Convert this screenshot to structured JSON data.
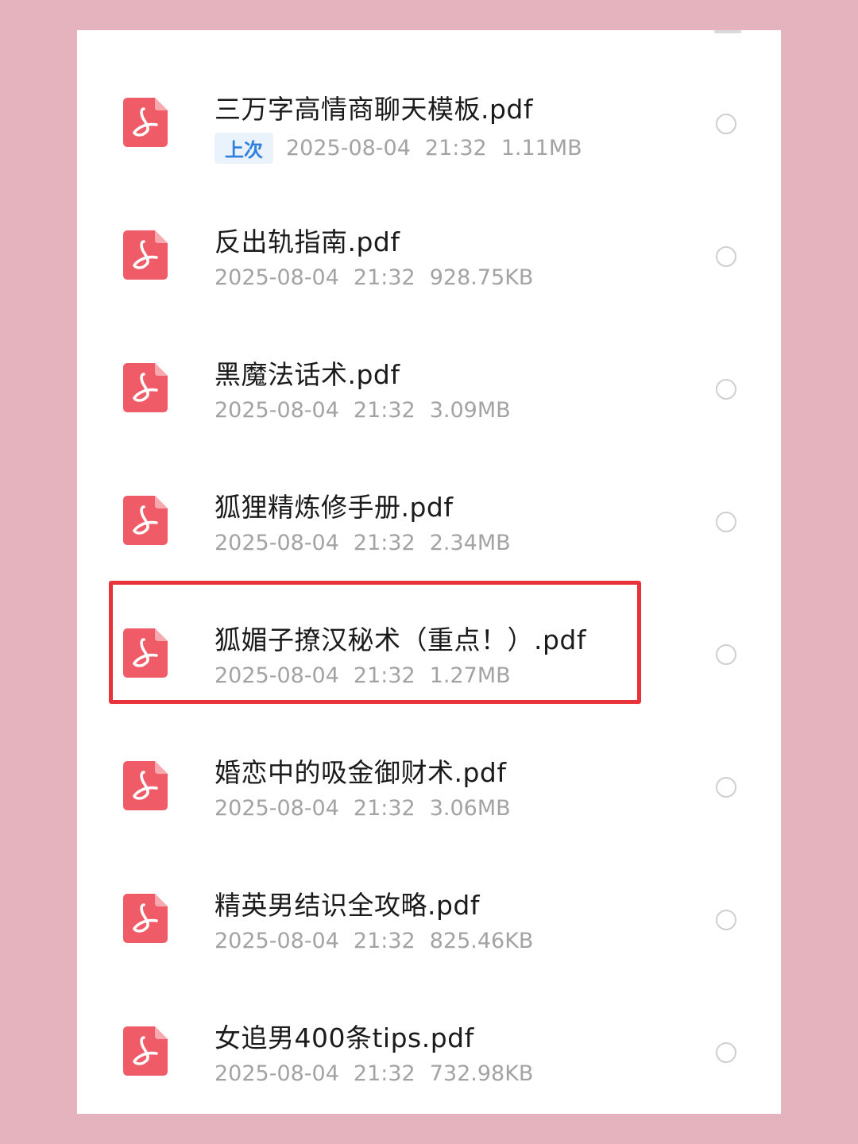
{
  "files": [
    {
      "name": "三万字高情商聊天模板.pdf",
      "badge": "上次",
      "date": "2025-08-04",
      "time": "21:32",
      "size": "1.11MB"
    },
    {
      "name": "反出轨指南.pdf",
      "date": "2025-08-04",
      "time": "21:32",
      "size": "928.75KB"
    },
    {
      "name": "黑魔法话术.pdf",
      "date": "2025-08-04",
      "time": "21:32",
      "size": "3.09MB"
    },
    {
      "name": "狐狸精炼修手册.pdf",
      "date": "2025-08-04",
      "time": "21:32",
      "size": "2.34MB"
    },
    {
      "name": "狐媚子撩汉秘术（重点！）.pdf",
      "date": "2025-08-04",
      "time": "21:32",
      "size": "1.27MB"
    },
    {
      "name": "婚恋中的吸金御财术.pdf",
      "date": "2025-08-04",
      "time": "21:32",
      "size": "3.06MB"
    },
    {
      "name": "精英男结识全攻略.pdf",
      "date": "2025-08-04",
      "time": "21:32",
      "size": "825.46KB"
    },
    {
      "name": "女追男400条tips.pdf",
      "date": "2025-08-04",
      "time": "21:32",
      "size": "732.98KB"
    }
  ],
  "icon": "pdf-file-icon",
  "colors": {
    "background": "#e4b3be",
    "icon": "#ef5b67",
    "highlight": "#e8333a",
    "badge_text": "#2f7fde"
  }
}
